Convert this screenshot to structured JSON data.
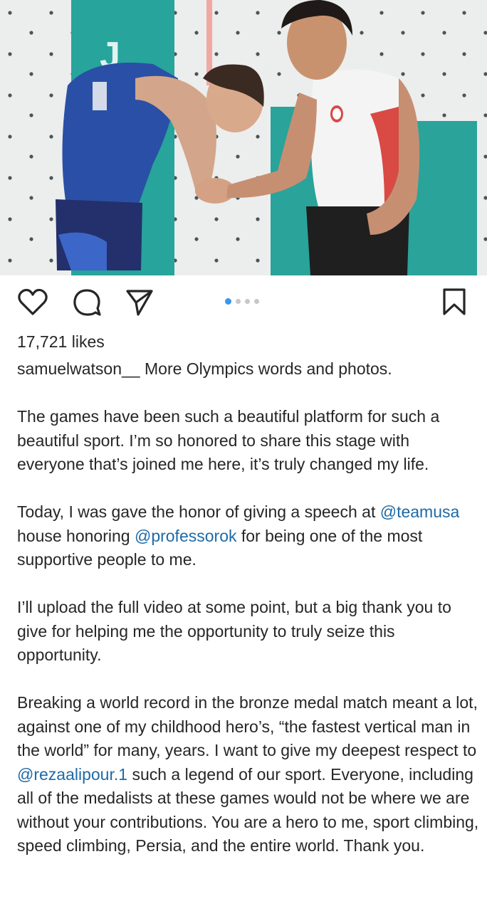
{
  "post": {
    "image_alt": "Two climbers shaking hands at climbing wall",
    "carousel": {
      "total": 4,
      "active": 1
    }
  },
  "actions": {
    "like_icon": "heart-icon",
    "comment_icon": "comment-icon",
    "share_icon": "paper-plane-icon",
    "save_icon": "bookmark-icon"
  },
  "likes": "17,721 likes",
  "caption": {
    "username": "samuelwatson__",
    "intro": " More Olympics words and photos.",
    "p1": "The games have been such a beautiful platform for such a beautiful sport. I’m so honored to share this stage with everyone that’s joined me here, it’s truly changed my life.",
    "p2_a": "Today, I was gave the honor of giving a speech at ",
    "p2_mention1": "@teamusa",
    "p2_b": " house honoring ",
    "p2_mention2": "@professorok",
    "p2_c": " for being one of the most supportive people to me.",
    "p3": "I’ll upload the full video  at some point, but a big thank you to give for helping me the opportunity to truly seize this opportunity.",
    "p4_a": "Breaking a world record in the bronze medal match meant a lot, against one of my childhood hero’s, “the fastest vertical man in the world” for many, years. I want to give my deepest respect to ",
    "p4_mention": "@rezaalipour.1",
    "p4_b": " such a legend of our sport. Everyone, including all of the medalists at these games would not be where we are without your contributions. You are a hero to me, sport climbing, speed climbing, Persia, and the entire world. Thank you."
  },
  "colors": {
    "mention": "#1e6aa7",
    "dot_active": "#3897f0",
    "text": "#262626"
  }
}
